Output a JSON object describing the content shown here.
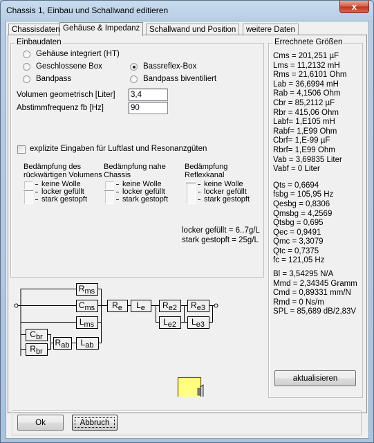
{
  "window": {
    "title": "Chassis 1, Einbau und Schallwand editieren",
    "close_icon": "close-x-icon",
    "close_glyph": "x"
  },
  "tabs": [
    {
      "label": "Chassisdaten",
      "active": false
    },
    {
      "label": "Gehäuse & Impedanz",
      "active": true
    },
    {
      "label": "Schallwand und Position",
      "active": false
    },
    {
      "label": "weitere Daten",
      "active": false
    }
  ],
  "einbaudaten": {
    "title": "Einbaudaten",
    "options": [
      {
        "label": "Gehäuse integriert (HT)",
        "checked": false
      },
      {
        "label": "Geschlossene Box",
        "checked": false
      },
      {
        "label": "Bandpass",
        "checked": false
      },
      {
        "label": "Bassreflex-Box",
        "checked": true
      },
      {
        "label": "Bandpass biventiliert",
        "checked": false
      }
    ],
    "volume_label": "Volumen geometrisch [Liter]",
    "volume_value": "3,4",
    "fb_label": "Abstimmfrequenz fb [Hz]",
    "fb_value": "90",
    "explicit_checkbox_label": "explizite Eingaben für Luftlast und Resonanzgüten",
    "explicit_checked": false,
    "damping": [
      {
        "title_line1": "Bedämpfung des",
        "title_line2": "rückwärtigen Volumens",
        "level_index": 1
      },
      {
        "title_line1": "Bedämpfung nahe",
        "title_line2": "Chassis",
        "level_index": 1
      },
      {
        "title_line1": "Bedämpfung",
        "title_line2": "Reflexkanal",
        "level_index": 0
      }
    ],
    "damping_levels": [
      "keine Wolle",
      "locker gefüllt",
      "stark gestopft"
    ],
    "note_line1": "locker gefüllt = 6..7g/L",
    "note_line2": "stark gestopft = 25g/L"
  },
  "circuit": {
    "components": {
      "rms": {
        "base": "R",
        "sub": "ms"
      },
      "cms": {
        "base": "C",
        "sub": "ms"
      },
      "lms": {
        "base": "L",
        "sub": "ms"
      },
      "cbr": {
        "base": "C",
        "sub": "br"
      },
      "rbr": {
        "base": "R",
        "sub": "br"
      },
      "rab": {
        "base": "R",
        "sub": "ab"
      },
      "lab": {
        "base": "L",
        "sub": "ab"
      },
      "re": {
        "base": "R",
        "sub": "e"
      },
      "le": {
        "base": "L",
        "sub": "e"
      },
      "re2": {
        "base": "R",
        "sub": "e2"
      },
      "le2": {
        "base": "L",
        "sub": "e2"
      },
      "re3": {
        "base": "R",
        "sub": "e3"
      },
      "le3": {
        "base": "L",
        "sub": "e3"
      }
    },
    "box_icon": "bassreflex-box-icon",
    "box_fill": "#ffff80",
    "box_stroke": "#7a4a00"
  },
  "results": {
    "title": "Errechnete Größen",
    "block1": [
      "Cms = 201,251 µF",
      "Lms = 11,2132 mH",
      "Rms = 21,6101 Ohm",
      "Lab = 36,6994 mH",
      "Rab = 4,1506 Ohm",
      "Cbr = 85,2112 µF",
      "Rbr = 415,06 Ohm",
      "Labf= 1,E105 mH",
      "Rabf= 1,E99 Ohm",
      "Cbrf= 1,E-99 µF",
      "Rbrf= 1,E99 Ohm",
      "Vab = 3,69835 Liter",
      "Vabf = 0 Liter"
    ],
    "block2": [
      "Qts = 0,6694",
      "fsbg = 105,95 Hz",
      "Qesbg = 0,8306",
      "Qmsbg = 4,2569",
      "Qtsbg = 0,695",
      "Qec = 0,9491",
      "Qmc = 3,3079",
      "Qtc = 0,7375",
      "fc  = 121,05 Hz"
    ],
    "block3": [
      "Bl  = 3,54295 N/A",
      "Mmd = 2,34345 Gramm",
      "Cmd = 0,89331 mm/N",
      "Rmd = 0 Ns/m",
      "SPL = 85,689 dB/2,83V"
    ],
    "update_button": "aktualisieren"
  },
  "footer": {
    "ok_button": "Ok",
    "cancel_button": "Abbruch"
  }
}
